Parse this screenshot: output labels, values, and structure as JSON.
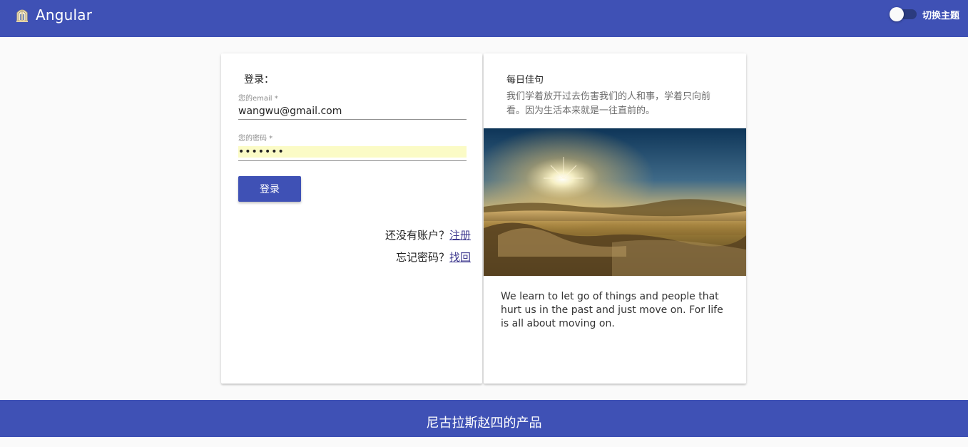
{
  "header": {
    "brand_icon": "angular-building-icon",
    "title": "Angular",
    "theme_toggle_label": "切换主题",
    "theme_toggle_on": false
  },
  "login": {
    "title": "登录：",
    "email_label": "您的email *",
    "email_value": "wangwu@gmail.com",
    "password_label": "您的密码 *",
    "password_value": "•••••••",
    "submit_label": "登录",
    "no_account_text": "还没有账户？",
    "register_link": "注册",
    "forgot_text": "忘记密码？",
    "recover_link": "找回"
  },
  "quote": {
    "title": "每日佳句",
    "cn": "我们学着放开过去伤害我们的人和事，学着只向前看。因为生活本来就是一往直前的。",
    "image": "sunrise-over-misty-valley-photo",
    "en": "We learn to let go of things and people that hurt us in the past and just move on. For life is all about moving on."
  },
  "footer": {
    "text": "尼古拉斯赵四的产品"
  },
  "colors": {
    "primary": "#3f51b5",
    "autofill": "#fbfbc6",
    "link": "#3f3a8f"
  }
}
